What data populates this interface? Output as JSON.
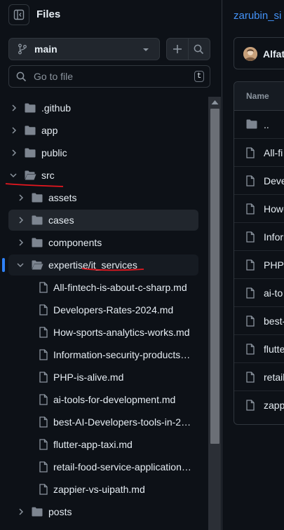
{
  "header": {
    "title": "Files"
  },
  "branch": {
    "name": "main"
  },
  "search": {
    "placeholder": "Go to file",
    "shortcut": "t"
  },
  "tree": [
    {
      "label": ".github",
      "type": "folder",
      "expanded": false,
      "level": 0
    },
    {
      "label": "app",
      "type": "folder",
      "expanded": false,
      "level": 0
    },
    {
      "label": "public",
      "type": "folder",
      "expanded": false,
      "level": 0
    },
    {
      "label": "src",
      "type": "folder",
      "expanded": true,
      "level": 0
    },
    {
      "label": "assets",
      "type": "folder",
      "expanded": false,
      "level": 1
    },
    {
      "label": "cases",
      "type": "folder",
      "expanded": false,
      "level": 1
    },
    {
      "label": "components",
      "type": "folder",
      "expanded": false,
      "level": 1
    },
    {
      "label": "expertise/it_services",
      "type": "folder",
      "expanded": true,
      "level": 1
    },
    {
      "label": "All-fintech-is-about-c-sharp.md",
      "type": "file",
      "level": 2
    },
    {
      "label": "Developers-Rates-2024.md",
      "type": "file",
      "level": 2
    },
    {
      "label": "How-sports-analytics-works.md",
      "type": "file",
      "level": 2
    },
    {
      "label": "Information-security-products…",
      "type": "file",
      "level": 2
    },
    {
      "label": "PHP-is-alive.md",
      "type": "file",
      "level": 2
    },
    {
      "label": "ai-tools-for-development.md",
      "type": "file",
      "level": 2
    },
    {
      "label": "best-AI-Developers-tools-in-2…",
      "type": "file",
      "level": 2
    },
    {
      "label": "flutter-app-taxi.md",
      "type": "file",
      "level": 2
    },
    {
      "label": "retail-food-service-application…",
      "type": "file",
      "level": 2
    },
    {
      "label": "zappier-vs-uipath.md",
      "type": "file",
      "level": 2
    },
    {
      "label": "posts",
      "type": "folder",
      "expanded": false,
      "level": 1
    }
  ],
  "repo": {
    "breadcrumb": "zarubin_si"
  },
  "commit": {
    "author": "Alfat"
  },
  "table": {
    "header": "Name",
    "rows": [
      {
        "name": "..",
        "type": "folder"
      },
      {
        "name": "All-fi",
        "type": "file"
      },
      {
        "name": "Deve",
        "type": "file"
      },
      {
        "name": "How-",
        "type": "file"
      },
      {
        "name": "Inforr",
        "type": "file"
      },
      {
        "name": "PHP-",
        "type": "file"
      },
      {
        "name": "ai-to",
        "type": "file"
      },
      {
        "name": "best-",
        "type": "file"
      },
      {
        "name": "flutte",
        "type": "file"
      },
      {
        "name": "retail",
        "type": "file"
      },
      {
        "name": "zapp",
        "type": "file"
      }
    ]
  },
  "colors": {
    "background": "#0d1117",
    "text": "#e6edf3",
    "muted": "#8b949e",
    "folder": "#7d8590",
    "link": "#4493f8",
    "accent": "#2f81f7",
    "annotation": "#e5171f"
  }
}
